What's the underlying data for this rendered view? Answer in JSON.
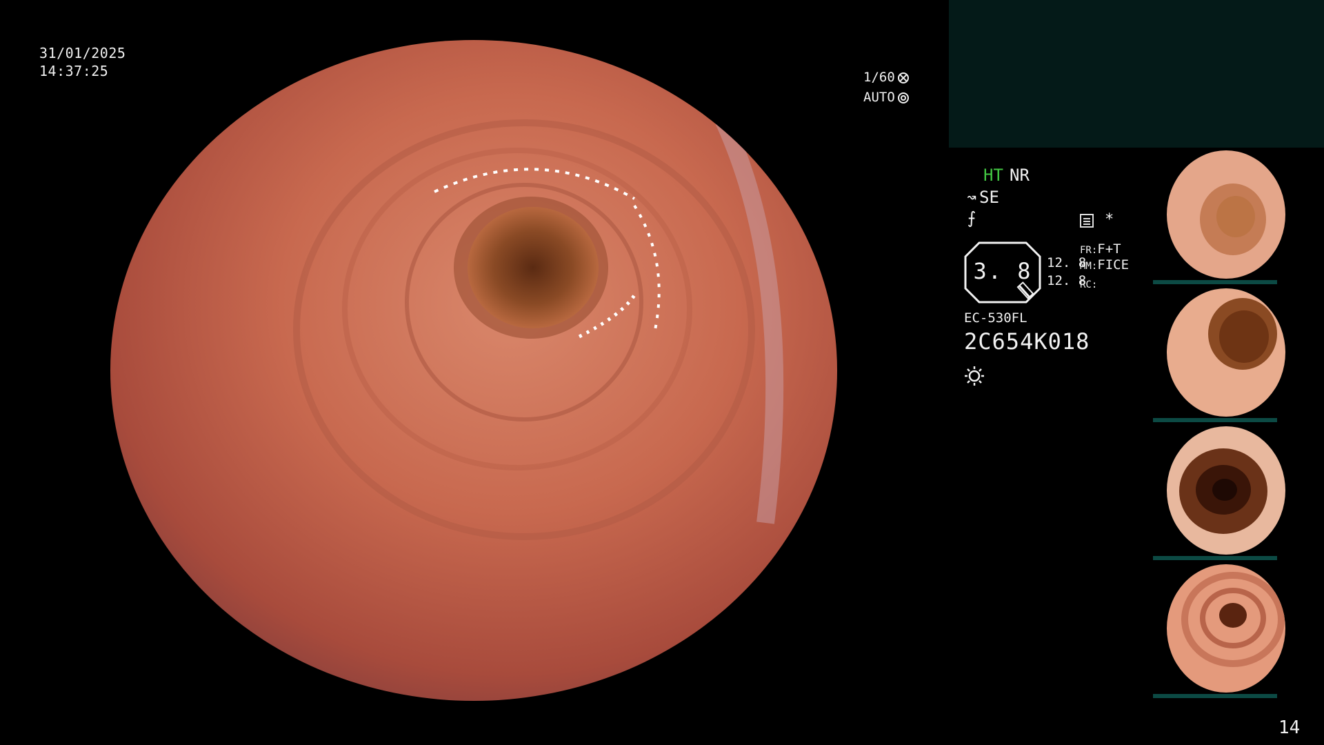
{
  "overlay": {
    "date": "31/01/2025",
    "time": "14:37:25"
  },
  "exposure": {
    "shutter": "1/60",
    "iris": "AUTO",
    "shutter_icon": "shutter-icon",
    "iris_icon": "iris-icon"
  },
  "modes": {
    "ht": "HT",
    "nr": "NR",
    "enhancement": "SE",
    "enhancement_icon": "enhancement-icon",
    "structure_icon": "structure-icon",
    "record_icon": "record-icon",
    "asterisk": "*"
  },
  "zoom": {
    "value": "3. 8",
    "num_a": "12. 8",
    "num_b": "12. 8"
  },
  "settings": {
    "fr_label": "FR:",
    "fr_value": "F+T",
    "mm_label": "MM:",
    "mm_value": "FICE",
    "rc_label": "RC:"
  },
  "scope": {
    "model": "EC-530FL",
    "serial": "2C654K018",
    "light_icon": "light-icon"
  },
  "page_number": "14",
  "colors": {
    "ht_green": "#43c843",
    "top_panel": "#041a18",
    "thumb_bar": "#0c4a44"
  }
}
